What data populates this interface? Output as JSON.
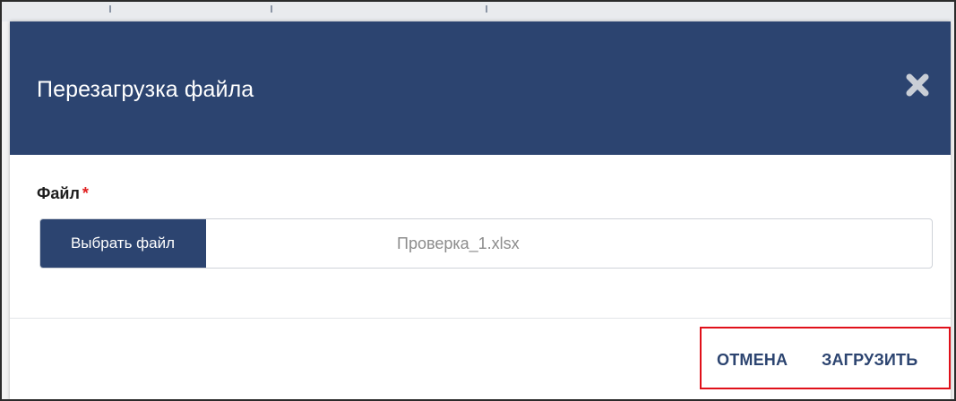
{
  "dialog": {
    "title": "Перезагрузка файла",
    "close_icon": "close-icon"
  },
  "file_field": {
    "label": "Файл",
    "required_marker": "*",
    "choose_button_label": "Выбрать файл",
    "file_name": "Проверка_1.xlsx"
  },
  "footer": {
    "cancel_label": "ОТМЕНА",
    "upload_label": "ЗАГРУЗИТЬ"
  },
  "colors": {
    "header_bg": "#2c4470",
    "accent_text": "#2c4470",
    "required": "#e02020",
    "highlight_border": "#e0101a"
  }
}
